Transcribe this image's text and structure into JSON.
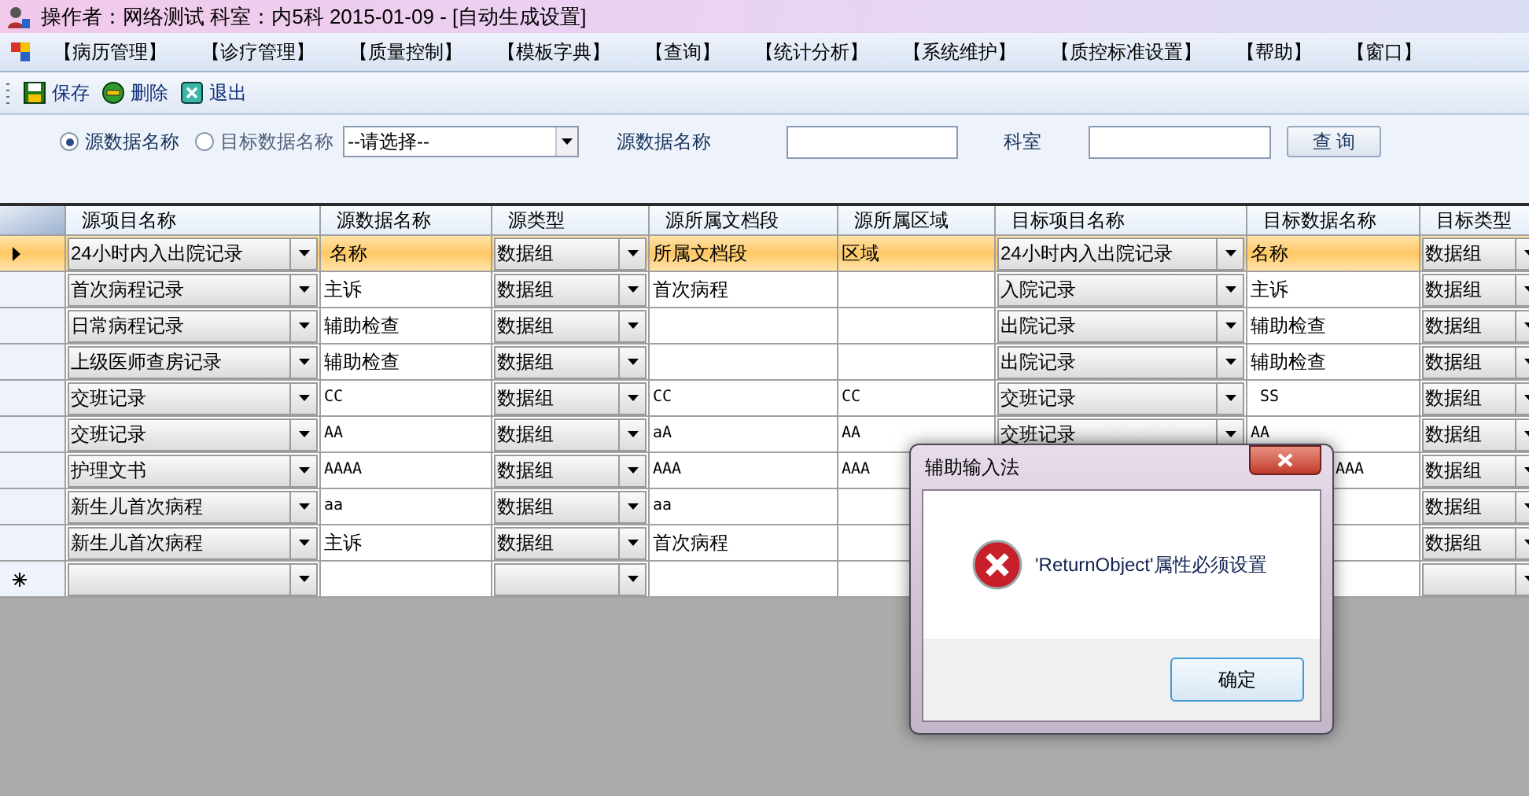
{
  "window": {
    "title": "操作者：网络测试  科室：内5科  2015-01-09 - [自动生成设置]"
  },
  "menu": [
    "【病历管理】",
    "【诊疗管理】",
    "【质量控制】",
    "【模板字典】",
    "【查询】",
    "【统计分析】",
    "【系统维护】",
    "【质控标准设置】",
    "【帮助】",
    "【窗口】"
  ],
  "toolbar": [
    {
      "kind": "save",
      "label": "保存"
    },
    {
      "kind": "delete",
      "label": "删除"
    },
    {
      "kind": "exit",
      "label": "退出"
    }
  ],
  "filter": {
    "radios": [
      {
        "label": "源数据名称",
        "selected": true
      },
      {
        "label": "目标数据名称",
        "selected": false
      }
    ],
    "select": "--请选择--",
    "source_label": "源数据名称",
    "dept_label": "科室",
    "query_button": "查 询"
  },
  "table": {
    "columns": [
      "源项目名称",
      "源数据名称",
      "源类型",
      "源所属文档段",
      "源所属区域",
      "目标项目名称",
      "目标数据名称",
      "目标类型"
    ],
    "rows": [
      {
        "current": true,
        "new": false,
        "cells": [
          {
            "kind": "combo",
            "text": "24小时内入出院记录"
          },
          {
            "kind": "text",
            "text": " 名称"
          },
          {
            "kind": "combo",
            "text": "数据组"
          },
          {
            "kind": "text",
            "text": "所属文档段"
          },
          {
            "kind": "text",
            "text": "区域"
          },
          {
            "kind": "combo",
            "text": "24小时内入出院记录"
          },
          {
            "kind": "text",
            "text": "名称"
          },
          {
            "kind": "combo",
            "text": "数据组"
          }
        ]
      },
      {
        "current": false,
        "new": false,
        "cells": [
          {
            "kind": "combo",
            "text": "首次病程记录"
          },
          {
            "kind": "text",
            "text": "主诉"
          },
          {
            "kind": "combo",
            "text": "数据组"
          },
          {
            "kind": "text",
            "text": "首次病程"
          },
          {
            "kind": "text"
          },
          {
            "kind": "combo",
            "text": "入院记录"
          },
          {
            "kind": "text",
            "text": "主诉"
          },
          {
            "kind": "combo",
            "text": "数据组"
          }
        ]
      },
      {
        "current": false,
        "new": false,
        "cells": [
          {
            "kind": "combo",
            "text": "日常病程记录"
          },
          {
            "kind": "text",
            "text": "辅助检查"
          },
          {
            "kind": "combo",
            "text": "数据组"
          },
          {
            "kind": "text"
          },
          {
            "kind": "text"
          },
          {
            "kind": "combo",
            "text": "出院记录"
          },
          {
            "kind": "text",
            "text": "辅助检查"
          },
          {
            "kind": "combo",
            "text": "数据组"
          }
        ]
      },
      {
        "current": false,
        "new": false,
        "cells": [
          {
            "kind": "combo",
            "text": "上级医师查房记录"
          },
          {
            "kind": "text",
            "text": "辅助检查"
          },
          {
            "kind": "combo",
            "text": "数据组"
          },
          {
            "kind": "text"
          },
          {
            "kind": "text"
          },
          {
            "kind": "combo",
            "text": "出院记录"
          },
          {
            "kind": "text",
            "text": "辅助检查"
          },
          {
            "kind": "combo",
            "text": "数据组"
          }
        ]
      },
      {
        "current": false,
        "new": false,
        "cells": [
          {
            "kind": "combo",
            "text": "交班记录"
          },
          {
            "kind": "code",
            "text": "CC"
          },
          {
            "kind": "combo",
            "text": "数据组"
          },
          {
            "kind": "code",
            "text": "CC"
          },
          {
            "kind": "code",
            "text": "CC"
          },
          {
            "kind": "combo",
            "text": "交班记录"
          },
          {
            "kind": "code",
            "text": " SS"
          },
          {
            "kind": "combo",
            "text": "数据组"
          }
        ]
      },
      {
        "current": false,
        "new": false,
        "cells": [
          {
            "kind": "combo",
            "text": "交班记录"
          },
          {
            "kind": "code",
            "text": "AA"
          },
          {
            "kind": "combo",
            "text": "数据组"
          },
          {
            "kind": "code",
            "text": "aA"
          },
          {
            "kind": "code",
            "text": "AA"
          },
          {
            "kind": "combo",
            "text": "交班记录"
          },
          {
            "kind": "code",
            "text": "AA"
          },
          {
            "kind": "combo",
            "text": "数据组"
          }
        ]
      },
      {
        "current": false,
        "new": false,
        "cells": [
          {
            "kind": "combo",
            "text": "护理文书"
          },
          {
            "kind": "code",
            "text": "AAAA"
          },
          {
            "kind": "combo",
            "text": "数据组"
          },
          {
            "kind": "code",
            "text": "AAA"
          },
          {
            "kind": "code",
            "text": "AAA"
          },
          {
            "kind": "hidden"
          },
          {
            "kind": "tail",
            "text": "AAA"
          },
          {
            "kind": "combo",
            "text": "数据组"
          }
        ]
      },
      {
        "current": false,
        "new": false,
        "cells": [
          {
            "kind": "combo",
            "text": "新生儿首次病程"
          },
          {
            "kind": "code",
            "text": "aa"
          },
          {
            "kind": "combo",
            "text": "数据组"
          },
          {
            "kind": "code",
            "text": "aa"
          },
          {
            "kind": "text"
          },
          {
            "kind": "hidden"
          },
          {
            "kind": "text"
          },
          {
            "kind": "combo",
            "text": "数据组"
          }
        ]
      },
      {
        "current": false,
        "new": false,
        "cells": [
          {
            "kind": "combo",
            "text": "新生儿首次病程"
          },
          {
            "kind": "text",
            "text": "主诉"
          },
          {
            "kind": "combo",
            "text": "数据组"
          },
          {
            "kind": "text",
            "text": "首次病程"
          },
          {
            "kind": "text"
          },
          {
            "kind": "hidden"
          },
          {
            "kind": "text"
          },
          {
            "kind": "combo",
            "text": "数据组"
          }
        ]
      },
      {
        "current": false,
        "new": true,
        "cells": [
          {
            "kind": "combo"
          },
          {
            "kind": "text"
          },
          {
            "kind": "combo"
          },
          {
            "kind": "text"
          },
          {
            "kind": "text"
          },
          {
            "kind": "hidden"
          },
          {
            "kind": "text"
          },
          {
            "kind": "combo"
          }
        ]
      }
    ]
  },
  "dialog": {
    "title": "辅助输入法",
    "message": "'ReturnObject'属性必须设置",
    "button": "确定"
  }
}
